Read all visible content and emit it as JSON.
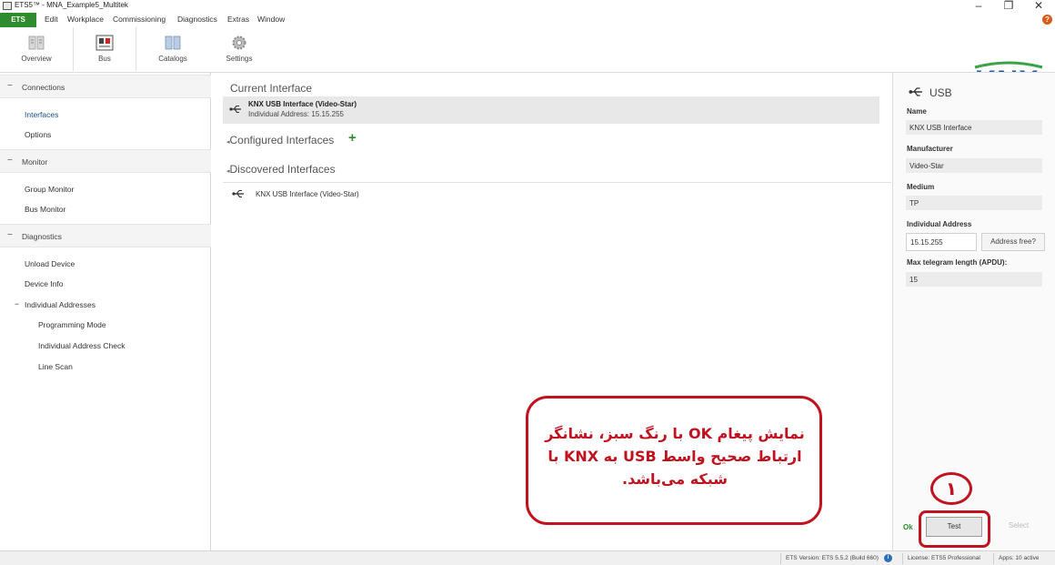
{
  "window": {
    "title": "ETS5™ - MNA_Example5_Multitek",
    "controls": {
      "minimize": "–",
      "maximize": "❐",
      "close": "✕"
    }
  },
  "menubar": {
    "app_button": "ETS",
    "items": [
      "Edit",
      "Workplace",
      "Commissioning",
      "Diagnostics",
      "Extras",
      "Window"
    ]
  },
  "ribbon": {
    "buttons": [
      {
        "label": "Overview",
        "icon": "overview-icon"
      },
      {
        "label": "Bus",
        "icon": "bus-icon"
      },
      {
        "label": "Catalogs",
        "icon": "catalogs-icon"
      },
      {
        "label": "Settings",
        "icon": "gear-icon"
      }
    ],
    "logo_text": "KNX"
  },
  "sidebar": {
    "sections": [
      {
        "label": "Connections",
        "toggle": "−",
        "items": [
          "Interfaces",
          "Options"
        ]
      },
      {
        "label": "Monitor",
        "toggle": "−",
        "items": [
          "Group Monitor",
          "Bus Monitor"
        ]
      },
      {
        "label": "Diagnostics",
        "toggle": "−",
        "items": [
          "Unload Device",
          "Device Info"
        ]
      }
    ],
    "individual_addresses": {
      "label": "Individual Addresses",
      "toggle": "−",
      "items": [
        "Programming Mode",
        "Individual Address Check",
        "Line Scan"
      ]
    },
    "selected": "Interfaces"
  },
  "main": {
    "current_interface_heading": "Current Interface",
    "current_interface": {
      "name": "KNX USB Interface (Video-Star)",
      "address": "Individual Address: 15.15.255"
    },
    "configured_heading": "Configured Interfaces",
    "add_icon": "+",
    "discovered_heading": "Discovered Interfaces",
    "discovered": [
      "KNX USB Interface (Video-Star)"
    ]
  },
  "properties": {
    "title": "USB",
    "name_label": "Name",
    "name_value": "KNX USB Interface",
    "manufacturer_label": "Manufacturer",
    "manufacturer_value": "Video-Star",
    "medium_label": "Medium",
    "medium_value": "TP",
    "address_label": "Individual Address",
    "address_value": "15.15.255",
    "address_button": "Address free?",
    "apdu_label": "Max telegram length (APDU):",
    "apdu_value": "15",
    "ok_text": "Ok",
    "test_button": "Test",
    "select_button": "Select"
  },
  "statusbar": {
    "version": "ETS Version: ETS 5.5.2 (Build 660)",
    "license": "License: ETS5 Professional",
    "apps": "Apps: 10 active"
  },
  "annotation": {
    "callout_text": "نمایش پیغام OK با رنگ سبز، نشانگر ارتباط صحیح واسط USB به KNX با شبکه می‌باشد.",
    "step_number": "۱"
  },
  "colors": {
    "accent_green": "#2e8b2e",
    "annotation_red": "#c1121f",
    "knx_blue": "#1c5aa6",
    "knx_green": "#3aa346"
  }
}
